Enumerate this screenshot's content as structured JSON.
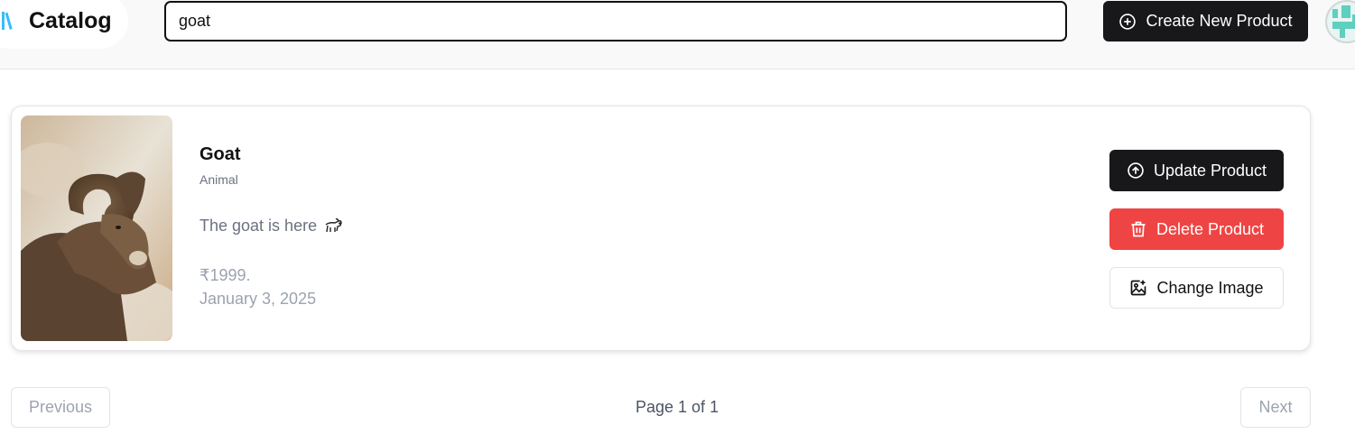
{
  "header": {
    "title": "Catalog",
    "search": {
      "value": "goat",
      "placeholder": ""
    },
    "create_label": "Create New Product",
    "brand_icon": "book-stack-icon",
    "avatar_icon": "avatar"
  },
  "product": {
    "name": "Goat",
    "category": "Animal",
    "description": "The goat is here",
    "description_icon": "goat-emoji",
    "price": "₹1999.",
    "date": "January 3, 2025",
    "image": "goat-photo"
  },
  "actions": {
    "update_label": "Update Product",
    "delete_label": "Delete Product",
    "change_image_label": "Change Image"
  },
  "pagination": {
    "previous_label": "Previous",
    "page_info": "Page 1 of 1",
    "next_label": "Next"
  },
  "colors": {
    "primary": "#18181b",
    "danger": "#ef4444",
    "brand_icon": "#38bdf8",
    "muted_text": "#6b7280"
  }
}
